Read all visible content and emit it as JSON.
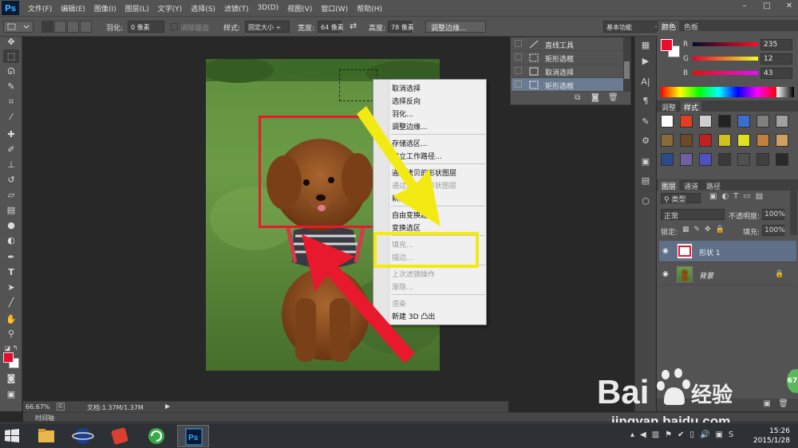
{
  "app": {
    "logo": "Ps"
  },
  "menubar": {
    "items": [
      "文件(F)",
      "编辑(E)",
      "图像(I)",
      "图层(L)",
      "文字(Y)",
      "选择(S)",
      "滤镜(T)",
      "3D(D)",
      "视图(V)",
      "窗口(W)",
      "帮助(H)"
    ],
    "window_controls": [
      "–",
      "□",
      "✕"
    ]
  },
  "optionsbar": {
    "feather_label": "羽化:",
    "feather_value": "0 像素",
    "antialias_label": "消除锯齿",
    "style_label": "样式:",
    "style_value": "固定大小",
    "width_label": "宽度:",
    "width_value": "64 像素",
    "height_label": "高度:",
    "height_value": "78 像素",
    "refine_edge_button": "调整边缘...",
    "workspace_value": "基本功能"
  },
  "context_menu": {
    "items": [
      {
        "label": "取消选择",
        "enabled": true
      },
      {
        "label": "选择反向",
        "enabled": true
      },
      {
        "label": "羽化...",
        "enabled": true
      },
      {
        "label": "调整边缘...",
        "enabled": true
      },
      {
        "label": "存储选区...",
        "enabled": true
      },
      {
        "label": "建立工作路径...",
        "enabled": true
      },
      {
        "label": "通过拷贝的形状图层",
        "enabled": true
      },
      {
        "label": "通过剪切的形状图层",
        "enabled": false
      },
      {
        "label": "新建图层...",
        "enabled": true
      },
      {
        "label": "自由变换路径",
        "enabled": true
      },
      {
        "label": "变换选区",
        "enabled": true
      },
      {
        "label": "填充...",
        "enabled": false
      },
      {
        "label": "描边...",
        "enabled": false
      },
      {
        "label": "上次滤镜操作",
        "enabled": false
      },
      {
        "label": "渐隐...",
        "enabled": false
      },
      {
        "label": "渲染",
        "enabled": false
      },
      {
        "label": "新建 3D 凸出",
        "enabled": true
      }
    ]
  },
  "history": {
    "items": [
      {
        "label": "直线工具",
        "icon": "line-tool-icon",
        "selected": false
      },
      {
        "label": "矩形选框",
        "icon": "marquee-icon",
        "selected": false
      },
      {
        "label": "取消选择",
        "icon": "marquee-icon",
        "selected": false
      },
      {
        "label": "矩形选框",
        "icon": "marquee-icon",
        "selected": true
      }
    ]
  },
  "color_panel": {
    "tabs": [
      "颜色",
      "色板"
    ],
    "r_label": "R",
    "r_value": "235",
    "g_label": "G",
    "g_value": "12",
    "b_label": "B",
    "b_value": "43",
    "foreground": "#eb0c2b"
  },
  "styles_panel": {
    "tabs": [
      "调整",
      "样式"
    ]
  },
  "layers_panel": {
    "tabs": [
      "图层",
      "通道",
      "路径"
    ],
    "filter_value": "类型",
    "blend_mode": "正常",
    "opacity_label": "不透明度:",
    "opacity_value": "100%",
    "lock_label": "锁定:",
    "fill_label": "填充:",
    "fill_value": "100%",
    "layers": [
      {
        "name": "形状 1",
        "selected": true
      },
      {
        "name": "背景",
        "selected": false,
        "locked": true
      }
    ]
  },
  "status": {
    "zoom": "66.67%",
    "doc_info": "文档:1.37M/1.37M"
  },
  "timeline": {
    "label": "时间轴"
  },
  "taskbar": {
    "time": "15:26",
    "date": "2015/1/28",
    "badge": "67"
  },
  "watermark": {
    "brand": "Bai",
    "brand_suffix": "经验",
    "url": "jingyan.baidu.com"
  },
  "colors": {
    "accent_red": "#e8192c",
    "annotation_yellow": "#f3ea14",
    "selection_blue": "#6b7b92"
  }
}
